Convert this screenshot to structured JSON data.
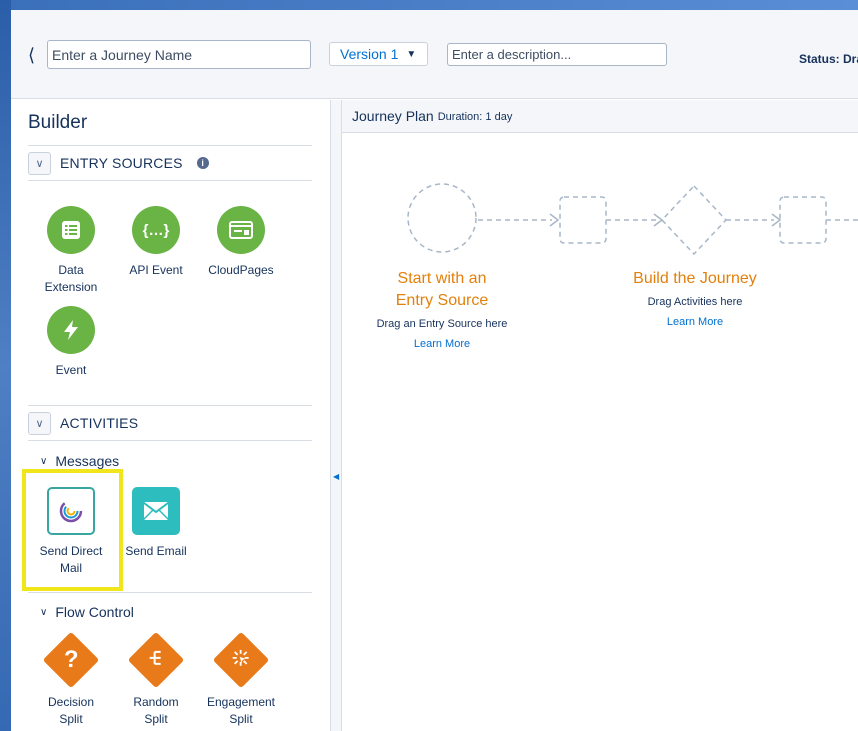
{
  "header": {
    "journey_name_placeholder": "Enter a Journey Name",
    "version_label": "Version 1",
    "description_placeholder": "Enter a description...",
    "status_label": "Status: Dra"
  },
  "builder": {
    "title": "Builder",
    "entry_sources": {
      "label": "ENTRY SOURCES",
      "items": [
        {
          "label": "Data Extension",
          "icon": "data-extension-icon"
        },
        {
          "label": "API Event",
          "icon": "api-event-icon"
        },
        {
          "label": "CloudPages",
          "icon": "cloudpages-icon"
        },
        {
          "label": "Event",
          "icon": "event-icon"
        }
      ]
    },
    "activities": {
      "label": "ACTIVITIES",
      "messages": {
        "label": "Messages",
        "items": [
          {
            "label": "Send Direct Mail",
            "icon": "direct-mail-icon"
          },
          {
            "label": "Send Email",
            "icon": "email-icon"
          }
        ]
      },
      "flow_control": {
        "label": "Flow Control",
        "items": [
          {
            "label": "Decision Split",
            "icon": "decision-split-icon"
          },
          {
            "label": "Random Split",
            "icon": "random-split-icon"
          },
          {
            "label": "Engagement Split",
            "icon": "engagement-split-icon"
          }
        ]
      }
    }
  },
  "canvas": {
    "plan_title": "Journey Plan",
    "duration": "Duration: 1 day",
    "entry": {
      "title_line1": "Start with an",
      "title_line2": "Entry Source",
      "subtitle": "Drag an Entry Source here",
      "link": "Learn More"
    },
    "build": {
      "title": "Build the Journey",
      "subtitle": "Drag Activities here",
      "link": "Learn More"
    }
  },
  "colors": {
    "entry_green": "#6ab345",
    "flow_orange": "#e87a1a",
    "email_teal": "#2ebdbe",
    "heading_orange": "#e3800c",
    "link_blue": "#0070d2",
    "highlight_yellow": "#f1e51c"
  }
}
